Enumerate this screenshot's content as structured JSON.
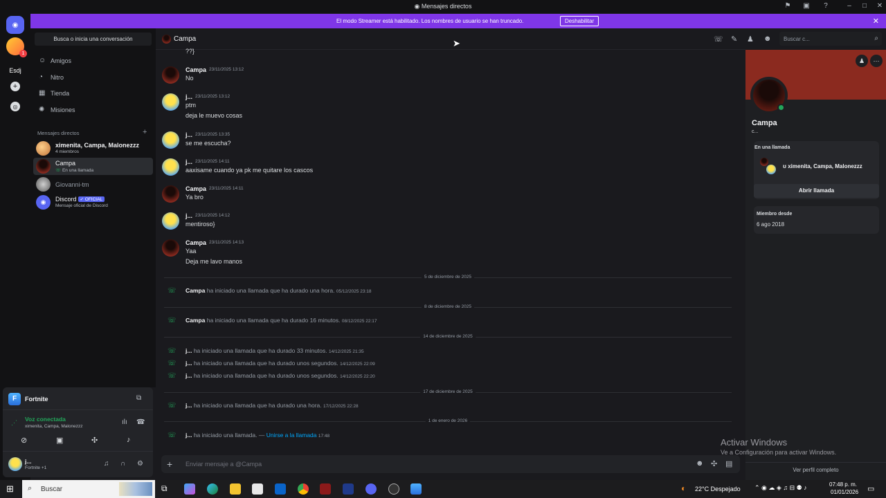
{
  "window": {
    "title": "Mensajes directos"
  },
  "streamer_banner": {
    "text": "El modo Streamer está habilitado. Los nombres de usuario se han truncado.",
    "button": "Deshabilitar"
  },
  "guilds": {
    "server_label": "Esdj",
    "badge_count": "1"
  },
  "dm_sidebar": {
    "search": "Busca o inicia una conversación",
    "nav": [
      {
        "label": "Amigos",
        "icon": "friends-icon"
      },
      {
        "label": "Nitro",
        "icon": "nitro-icon"
      },
      {
        "label": "Tienda",
        "icon": "shop-icon"
      },
      {
        "label": "Misiones",
        "icon": "quests-icon"
      }
    ],
    "dm_header": "Mensajes directos",
    "dms": [
      {
        "name": "ximenita, Campa, Malonezzz",
        "sub": "4 miembros"
      },
      {
        "name": "Campa",
        "sub": "En una llamada"
      },
      {
        "name": "Giovanni-tm",
        "sub": ""
      },
      {
        "name": "Discord",
        "badge": "✓ OFICIAL",
        "sub": "Mensaje oficial de Discord"
      }
    ]
  },
  "user_panel": {
    "activity": "Fortnite",
    "voice_status": "Voz conectada",
    "voice_channel": "ximenita, Campa, Malonezzz",
    "username": "j...",
    "user_status": "Fortnite +1"
  },
  "chat": {
    "recipient": "Campa",
    "search_placeholder": "Buscar c...",
    "top_fragment": "??}",
    "messages": [
      {
        "author": "Campa",
        "ts": "23/11/2025 13:12",
        "lines": [
          "No"
        ],
        "avatar": "dark"
      },
      {
        "author": "j...",
        "ts": "23/11/2025 13:12",
        "lines": [
          "ptm",
          "deja le muevo cosas"
        ],
        "avatar": "blue"
      },
      {
        "author": "j...",
        "ts": "23/11/2025 13:35",
        "lines": [
          "se me escucha?"
        ],
        "avatar": "blue"
      },
      {
        "author": "j...",
        "ts": "23/11/2025 14:11",
        "lines": [
          "aaxisame cuando ya pk me quitare los cascos"
        ],
        "avatar": "blue"
      },
      {
        "author": "Campa",
        "ts": "23/11/2025 14:11",
        "lines": [
          "Ya bro"
        ],
        "avatar": "dark"
      },
      {
        "author": "j...",
        "ts": "23/11/2025 14:12",
        "lines": [
          "mentiroso}"
        ],
        "avatar": "blue"
      },
      {
        "author": "Campa",
        "ts": "23/11/2025 14:13",
        "lines": [
          "Yaa",
          "Deja me lavo manos"
        ],
        "avatar": "dark"
      }
    ],
    "dividers": [
      "5 de diciembre de 2025",
      "8 de diciembre de 2025",
      "14 de diciembre de 2025",
      "17 de diciembre de 2025",
      "1 de enero de 2026"
    ],
    "calls": [
      {
        "author": "Campa",
        "text": "ha iniciado una llamada que ha durado una hora.",
        "time": "05/12/2025 23:18"
      },
      {
        "author": "Campa",
        "text": "ha iniciado una llamada que ha durado 16 minutos.",
        "time": "08/12/2025 22:17"
      },
      {
        "author": "j...",
        "text": "ha iniciado una llamada que ha durado 33 minutos.",
        "time": "14/12/2025 21:35"
      },
      {
        "author": "j...",
        "text": "ha iniciado una llamada que ha durado unos segundos.",
        "time": "14/12/2025 22:09"
      },
      {
        "author": "j...",
        "text": "ha iniciado una llamada que ha durado unos segundos.",
        "time": "14/12/2025 22:20"
      },
      {
        "author": "j...",
        "text": "ha iniciado una llamada que ha durado una hora.",
        "time": "17/12/2025 22:28"
      },
      {
        "author": "j...",
        "text": "ha iniciado una llamada. —",
        "join": "Unirse a la llamada",
        "time": "17:48"
      }
    ],
    "composer_placeholder": "Enviar mensaje a @Campa"
  },
  "profile": {
    "name": "Campa",
    "tag": "c...",
    "in_call_label": "En una llamada",
    "call_members": "ximenita, Campa, Malonezzz",
    "open_call": "Abrir llamada",
    "member_since_label": "Miembro desde",
    "member_since": "6 ago 2018",
    "full_profile": "Ver perfil completo"
  },
  "watermark": {
    "title": "Activar Windows",
    "sub": "Ve a Configuración para activar Windows."
  },
  "taskbar": {
    "search": "Buscar",
    "weather": "22°C  Despejado",
    "time": "07:48 p. m.",
    "date": "01/01/2026"
  },
  "colors": {
    "streamer": "#7f36e8",
    "accent": "#5865f2",
    "online": "#23a55a",
    "link": "#00a8fc",
    "profile_banner": "#8b2a1f"
  }
}
